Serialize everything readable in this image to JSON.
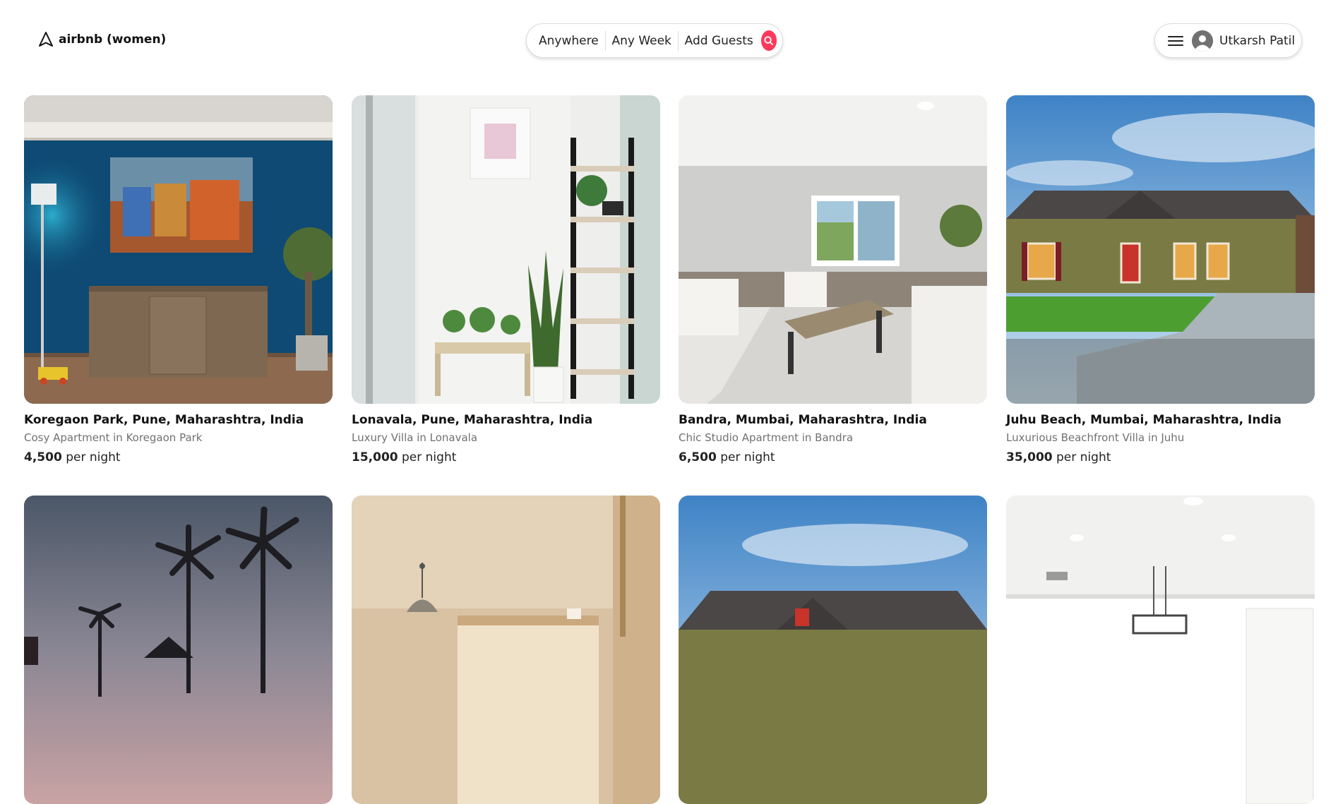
{
  "header": {
    "logo_text": "airbnb (women)",
    "search": {
      "anywhere": "Anywhere",
      "any_week": "Any Week",
      "add_guests": "Add Guests"
    },
    "user": {
      "name": "Utkarsh Patil"
    }
  },
  "colors": {
    "accent": "#ff385c",
    "muted_text": "#717171"
  },
  "listings": [
    {
      "location": "Koregaon Park, Pune, Maharashtra, India",
      "description": "Cosy Apartment in Koregaon Park",
      "price": "4,500",
      "price_suffix": "per night"
    },
    {
      "location": "Lonavala, Pune, Maharashtra, India",
      "description": "Luxury Villa in Lonavala",
      "price": "15,000",
      "price_suffix": "per night"
    },
    {
      "location": "Bandra, Mumbai, Maharashtra, India",
      "description": "Chic Studio Apartment in Bandra",
      "price": "6,500",
      "price_suffix": "per night"
    },
    {
      "location": "Juhu Beach, Mumbai, Maharashtra, India",
      "description": "Luxurious Beachfront Villa in Juhu",
      "price": "35,000",
      "price_suffix": "per night"
    }
  ]
}
